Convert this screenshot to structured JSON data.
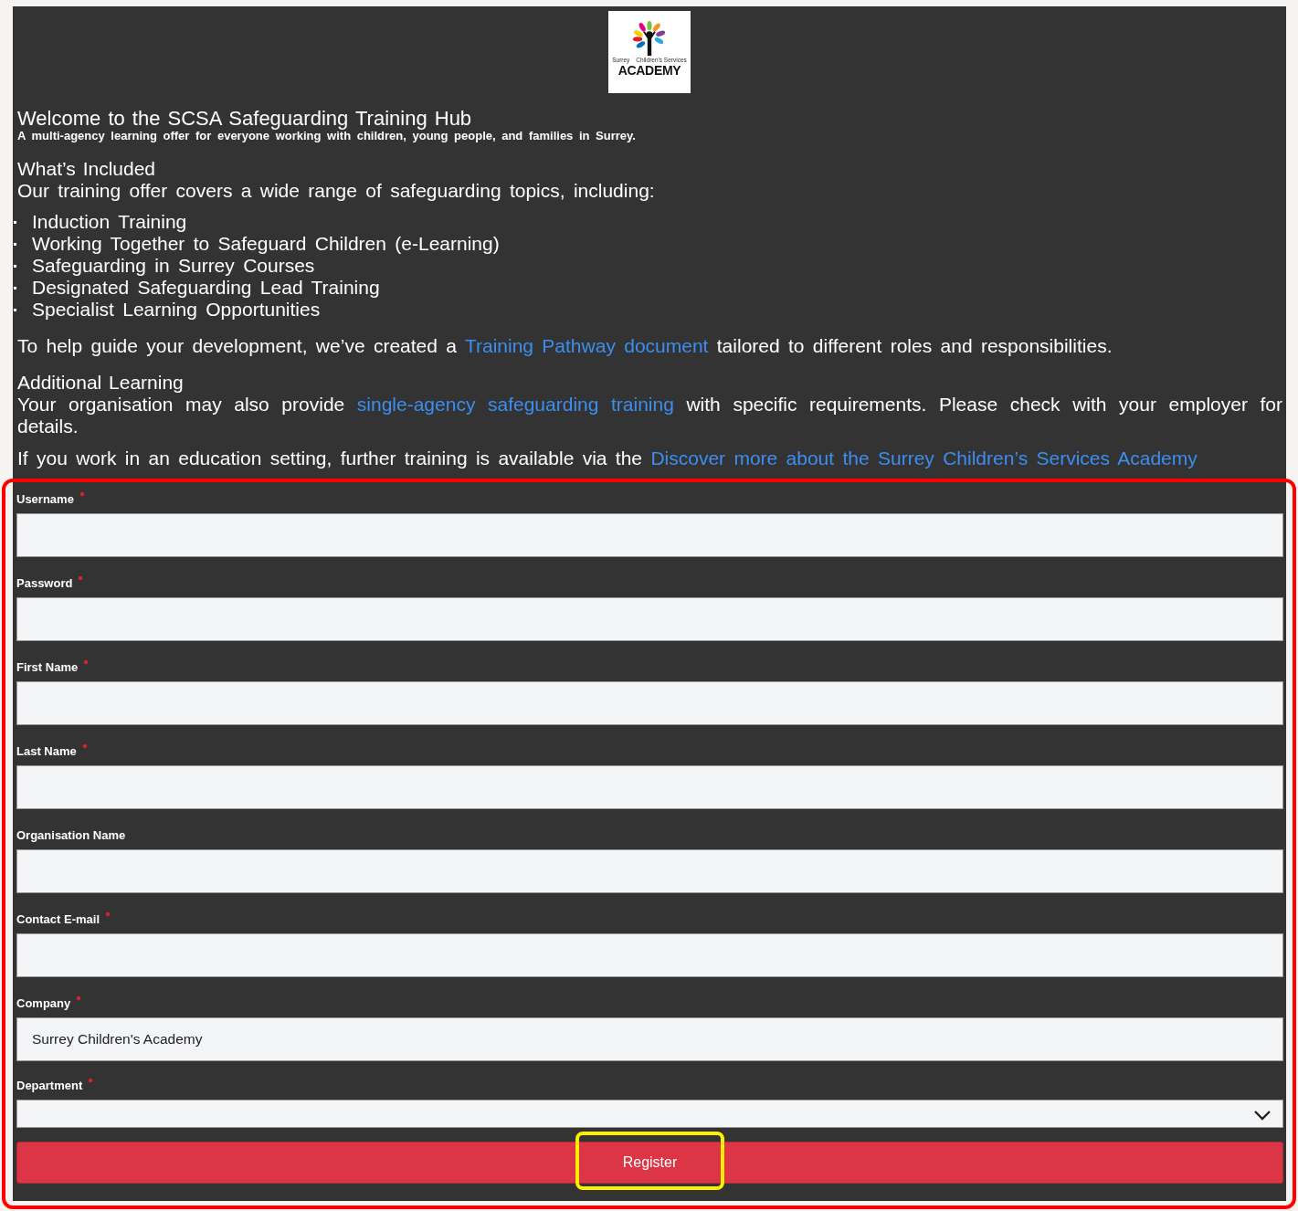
{
  "logo": {
    "small_left": "Surrey",
    "small_right": "Children's Services",
    "name": "ACADEMY"
  },
  "intro": {
    "title": "Welcome to the SCSA Safeguarding Training Hub",
    "subtitle": "A multi-agency learning offer for everyone working with children, young people, and families in Surrey."
  },
  "included": {
    "heading": "What’s Included",
    "lead": "Our training offer covers a wide range of safeguarding topics, including:",
    "items": [
      "Induction Training",
      "Working Together to Safeguard Children (e-Learning)",
      "Safeguarding in Surrey Courses",
      "Designated Safeguarding Lead Training",
      "Specialist Learning Opportunities"
    ]
  },
  "pathway": [
    {
      "text": "To help guide your development, we’ve created a ",
      "link": false
    },
    {
      "text": "Training Pathway document",
      "link": true
    },
    {
      "text": " tailored to different roles and responsibilities.",
      "link": false
    }
  ],
  "additional": {
    "heading": "Additional Learning",
    "body": [
      {
        "text": "Your organisation may also provide ",
        "link": false
      },
      {
        "text": "single-agency safeguarding training",
        "link": true
      },
      {
        "text": " with specific requirements. Please check with your employer for details.",
        "link": false
      }
    ],
    "education": [
      {
        "text": "If you work in an education setting, further training is available via the ",
        "link": false
      },
      {
        "text": "Discover more about the Surrey Children’s Services Academy",
        "link": true
      }
    ]
  },
  "form": {
    "fields": [
      {
        "label": "Username",
        "required": true,
        "kind": "text"
      },
      {
        "label": "Password",
        "required": true,
        "kind": "text"
      },
      {
        "label": "First Name",
        "required": true,
        "kind": "text"
      },
      {
        "label": "Last Name",
        "required": true,
        "kind": "text"
      },
      {
        "label": "Organisation Name",
        "required": false,
        "kind": "text"
      },
      {
        "label": "Contact E-mail",
        "required": true,
        "kind": "text"
      },
      {
        "label": "Company",
        "required": true,
        "kind": "text",
        "value": "Surrey Children's Academy"
      },
      {
        "label": "Department",
        "required": true,
        "kind": "select"
      }
    ],
    "submit": "Register"
  }
}
